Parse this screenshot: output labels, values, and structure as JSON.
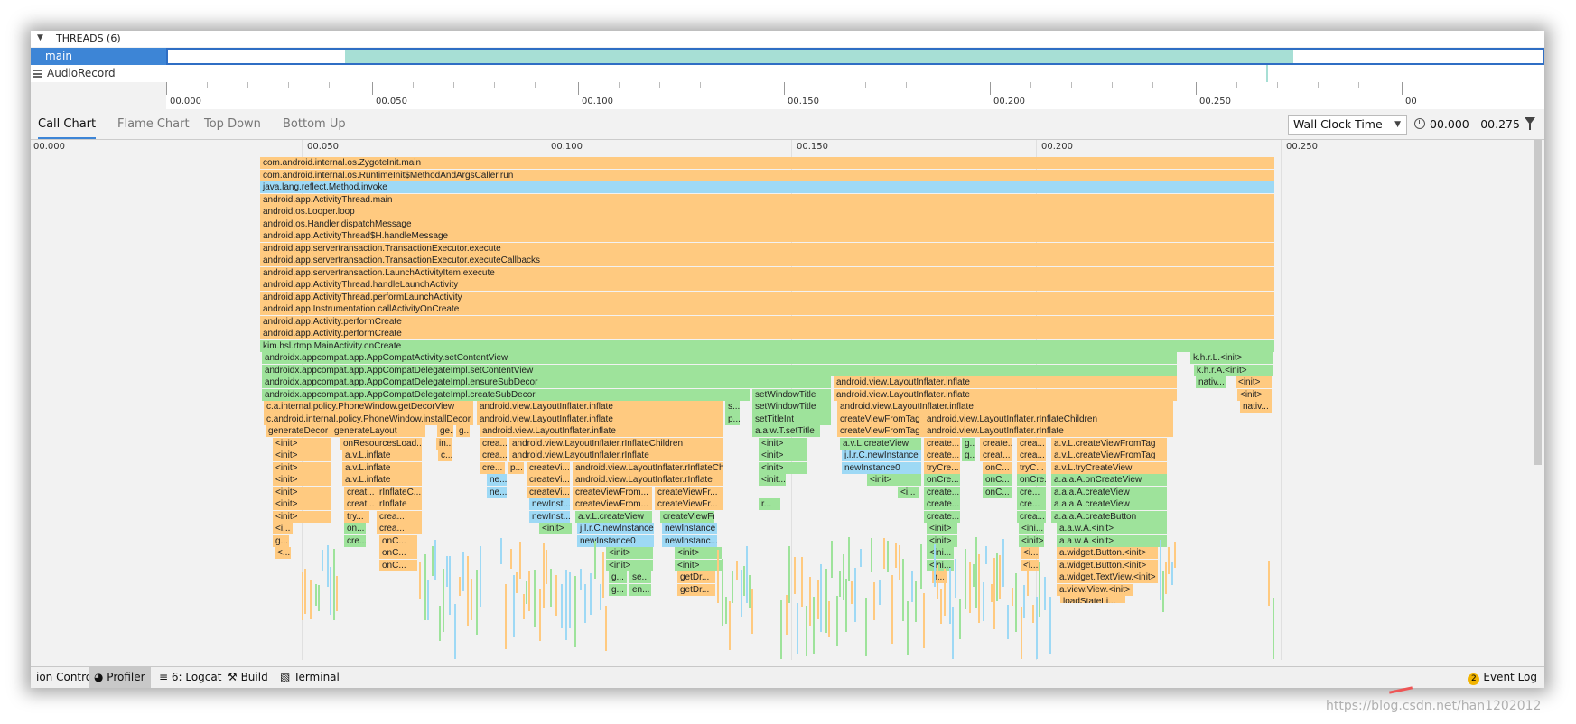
{
  "threads": {
    "header": "THREADS (6)",
    "items": [
      {
        "name": "main"
      },
      {
        "name": "AudioRecord"
      }
    ]
  },
  "timeline_ticks": [
    "00.000",
    "00.050",
    "00.100",
    "00.150",
    "00.200",
    "00.250",
    "00"
  ],
  "tabs": [
    "Call Chart",
    "Flame Chart",
    "Top Down",
    "Bottom Up"
  ],
  "clock": {
    "selected": "Wall Clock Time",
    "range": "00.000 - 00.275"
  },
  "chart_ticks": [
    "00.000",
    "00.050",
    "00.100",
    "00.150",
    "00.200",
    "00.250"
  ],
  "frames_base": [
    "com.android.internal.os.ZygoteInit.main",
    "com.android.internal.os.RuntimeInit$MethodAndArgsCaller.run",
    "java.lang.reflect.Method.invoke",
    "android.app.ActivityThread.main",
    "android.os.Looper.loop",
    "android.os.Handler.dispatchMessage",
    "android.app.ActivityThread$H.handleMessage",
    "android.app.servertransaction.TransactionExecutor.execute",
    "android.app.servertransaction.TransactionExecutor.executeCallbacks",
    "android.app.servertransaction.LaunchActivityItem.execute",
    "android.app.ActivityThread.handleLaunchActivity",
    "android.app.ActivityThread.performLaunchActivity",
    "android.app.Instrumentation.callActivityOnCreate",
    "android.app.Activity.performCreate",
    "android.app.Activity.performCreate",
    "kim.hsl.rtmp.MainActivity.onCreate"
  ],
  "frames_app": [
    "androidx.appcompat.app.AppCompatActivity.setContentView",
    "androidx.appcompat.app.AppCompatDelegateImpl.setContentView",
    "androidx.appcompat.app.AppCompatDelegateImpl.ensureSubDecor",
    "androidx.appcompat.app.AppCompatDelegateImpl.createSubDecor"
  ],
  "frames_misc": {
    "khrl_init": "k.h.r.L.<init>",
    "khra_init": "k.h.r.A.<init>",
    "nativ": "nativ...",
    "init": "<init>",
    "phonewindow_getdecor": "c.a.internal.policy.PhoneWindow.getDecorView",
    "phonewindow_installdecor": "c.android.internal.policy.PhoneWindow.installDecor",
    "generate_decor": "generateDecor",
    "generate_layout": "generateLayout",
    "inflate": "android.view.LayoutInflater.inflate",
    "rinflate_children": "android.view.LayoutInflater.rInflateChildren",
    "rinflate": "android.view.LayoutInflater.rInflate",
    "set_window_title": "setWindowTitle",
    "set_title_int": "setTitleInt",
    "aawt_settitle": "a.a.w.T.setTitle",
    "create_view_from_tag": "createViewFromTag",
    "avl_create_view": "a.v.L.createView",
    "avl_create_view_from_tag": "a.v.L.createViewFromTag",
    "jlrc_newinstance": "j.l.r.C.newInstance",
    "newinstance0": "newInstance0",
    "newinstance": "newInstance",
    "avl_try_create_view": "a.v.L.tryCreateView",
    "aaaa_oncreateview": "a.a.a.A.onCreateView",
    "aaaa_createview": "a.a.a.A.createView",
    "aaaa_createbutton": "a.a.a.A.createButton",
    "aawa_init": "a.a.w.A.<init>",
    "widget_button_init": "a.widget.Button.<init>",
    "widget_textview_init": "a.widget.TextView.<init>",
    "view_init": "a.view.View.<init>",
    "avl_inflate": "a.v.L.inflate",
    "on_resources_load": "onResourcesLoad...",
    "create_view_from_abbr": "createViewFrom...",
    "create_view_fr": "createViewFr...",
    "newinst_abbr": "newInst...",
    "newinstance_abbr": "newInstanc...",
    "create_abbr": "create...",
    "oncre_abbr": "onCre...",
    "createvi_abbr": "createVi...",
    "tryc_abbr": "tryC...",
    "trycre_abbr": "tryCre...",
    "cre_abbr": "cre...",
    "crea_abbr": "crea...",
    "creat_abbr": "creat...",
    "rinflatec_abbr": "rInflateC...",
    "rinflate_abbr": "rInflate",
    "try_abbr": "try...",
    "on_abbr": "on...",
    "onc_abbr": "onC...",
    "ge_abbr": "ge...",
    "g_abbr": "g...",
    "in_abbr": "in...",
    "c_abbr": "c...",
    "s_abbr": "s...",
    "p_abbr": "p...",
    "ne_abbr": "ne...",
    "r_abbr": "r...",
    "i_abbr": "<i...",
    "lt_abbr": "<...",
    "init_abbr": "<init...",
    "ini_abbr": "<ini...",
    "se_abbr": "se...",
    "en_abbr": "en...",
    "getdr_abbr": "getDr...",
    "loadstatel_abbr": "loadStateLi..."
  },
  "bottom_toolbar": {
    "version_control": "ion Control",
    "profiler": "Profiler",
    "logcat": "6: Logcat",
    "build": "Build",
    "terminal": "Terminal",
    "event_log": "Event Log",
    "event_count": "2"
  },
  "watermark": "https://blog.csdn.net/han1202012"
}
